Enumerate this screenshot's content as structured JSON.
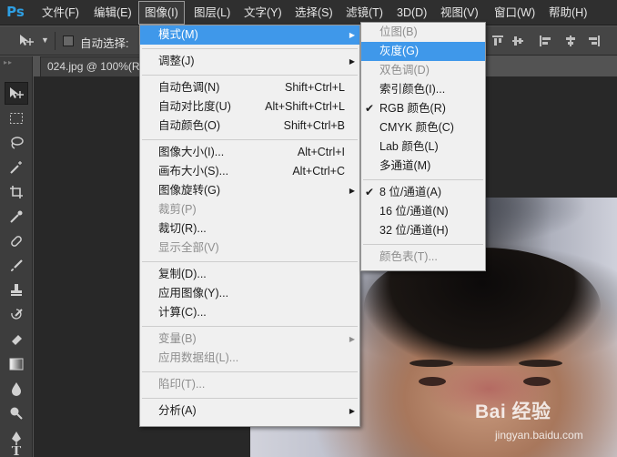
{
  "app": {
    "logo": "Ps",
    "menubar": [
      "文件(F)",
      "编辑(E)",
      "图像(I)",
      "图层(L)",
      "文字(Y)",
      "选择(S)",
      "滤镜(T)",
      "3D(D)",
      "视图(V)",
      "窗口(W)",
      "帮助(H)"
    ],
    "active_menu": "图像(I)"
  },
  "options_bar": {
    "auto_select_label": "自动选择:",
    "auto_select_checked": false
  },
  "document": {
    "tab_title": "024.jpg @ 100%(R"
  },
  "image_menu": {
    "items": [
      {
        "label": "模式(M)",
        "shortcut": "",
        "submenu": true,
        "disabled": false,
        "highlighted": true
      },
      {
        "separator": true
      },
      {
        "label": "调整(J)",
        "shortcut": "",
        "submenu": true,
        "disabled": false
      },
      {
        "separator": true
      },
      {
        "label": "自动色调(N)",
        "shortcut": "Shift+Ctrl+L",
        "disabled": false
      },
      {
        "label": "自动对比度(U)",
        "shortcut": "Alt+Shift+Ctrl+L",
        "disabled": false
      },
      {
        "label": "自动颜色(O)",
        "shortcut": "Shift+Ctrl+B",
        "disabled": false
      },
      {
        "separator": true
      },
      {
        "label": "图像大小(I)...",
        "shortcut": "Alt+Ctrl+I",
        "disabled": false
      },
      {
        "label": "画布大小(S)...",
        "shortcut": "Alt+Ctrl+C",
        "disabled": false
      },
      {
        "label": "图像旋转(G)",
        "shortcut": "",
        "submenu": true,
        "disabled": false
      },
      {
        "label": "裁剪(P)",
        "shortcut": "",
        "disabled": true
      },
      {
        "label": "裁切(R)...",
        "shortcut": "",
        "disabled": false
      },
      {
        "label": "显示全部(V)",
        "shortcut": "",
        "disabled": true
      },
      {
        "separator": true
      },
      {
        "label": "复制(D)...",
        "shortcut": "",
        "disabled": false
      },
      {
        "label": "应用图像(Y)...",
        "shortcut": "",
        "disabled": false
      },
      {
        "label": "计算(C)...",
        "shortcut": "",
        "disabled": false
      },
      {
        "separator": true
      },
      {
        "label": "变量(B)",
        "shortcut": "",
        "submenu": true,
        "disabled": true
      },
      {
        "label": "应用数据组(L)...",
        "shortcut": "",
        "disabled": true
      },
      {
        "separator": true
      },
      {
        "label": "陷印(T)...",
        "shortcut": "",
        "disabled": true
      },
      {
        "separator": true
      },
      {
        "label": "分析(A)",
        "shortcut": "",
        "submenu": true,
        "disabled": false
      }
    ]
  },
  "mode_submenu": {
    "items": [
      {
        "label": "位图(B)",
        "disabled": true
      },
      {
        "label": "灰度(G)",
        "highlighted": true
      },
      {
        "label": "双色调(D)",
        "disabled": true
      },
      {
        "label": "索引颜色(I)..."
      },
      {
        "label": "RGB 颜色(R)",
        "checked": true
      },
      {
        "label": "CMYK 颜色(C)"
      },
      {
        "label": "Lab 颜色(L)"
      },
      {
        "label": "多通道(M)"
      },
      {
        "separator": true
      },
      {
        "label": "8 位/通道(A)",
        "checked": true
      },
      {
        "label": "16 位/通道(N)"
      },
      {
        "label": "32 位/通道(H)"
      },
      {
        "separator": true
      },
      {
        "label": "颜色表(T)...",
        "disabled": true
      }
    ]
  },
  "watermark": {
    "logo": "Bai 经验",
    "url": "jingyan.baidu.com"
  },
  "icons": {
    "check": "✔",
    "submenu_arrow": "▶"
  }
}
